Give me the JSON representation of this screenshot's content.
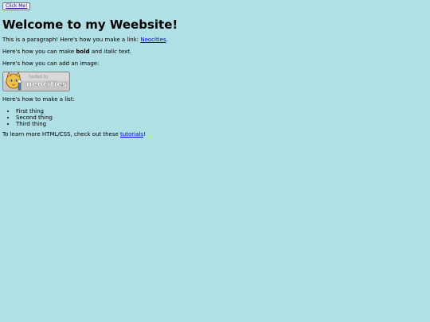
{
  "button": {
    "label": "Click Me!"
  },
  "page": {
    "title": "Welcome to my Weebsite!",
    "para1_prefix": "This is a paragraph! Here's how you make a link: ",
    "para1_link": "Neocities",
    "para1_suffix": ".",
    "para2_prefix": "Here's how you can make ",
    "para2_bold": "bold",
    "para2_mid": " and ",
    "para2_italic": "italic",
    "para2_suffix": " text.",
    "para3": "Here's how you can add an image:",
    "badge_text_small": "hosted by",
    "badge_text_big": "neocities",
    "para4": "Here's how to make a list:",
    "list": [
      "First thing",
      "Second thing",
      "Third thing"
    ],
    "para5_prefix": "To learn more HTML/CSS, check out these ",
    "para5_link": "tutorials",
    "para5_suffix": "!"
  },
  "colors": {
    "background": "#b0e0e6",
    "link": "#0000ee"
  }
}
